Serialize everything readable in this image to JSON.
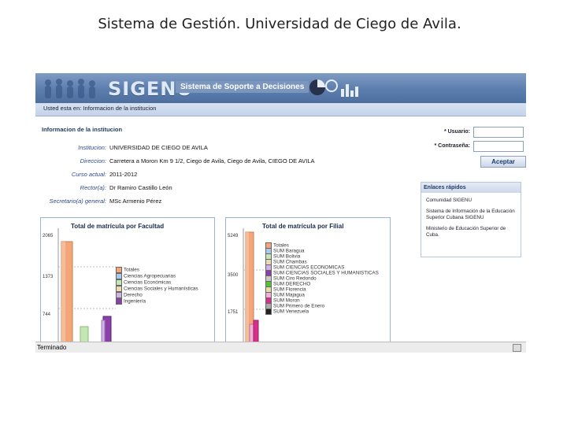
{
  "slide_title": "Sistema de Gestión. Universidad de Ciego de Avila.",
  "app": {
    "brand": "SIGENU",
    "subtitle": "Sistema de Soporte a Decisiones"
  },
  "breadcrumb": "Usted esta en: Informacion de la institucion",
  "institution": {
    "section_title": "Informacion de la institucion",
    "rows": [
      {
        "label": "Institucion:",
        "value": "UNIVERSIDAD DE CIEGO DE AVILA"
      },
      {
        "label": "Direccion:",
        "value": "Carretera a Moron Km 9 1/2, Ciego de Avila, Ciego de Avila, CIEGO DE AVILA"
      },
      {
        "label": "Curso actual:",
        "value": "2011-2012"
      },
      {
        "label": "Rector(a):",
        "value": "Dr Ramiro Castillo León"
      },
      {
        "label": "Secretario(a) general:",
        "value": "MSc Armenio Pérez"
      }
    ]
  },
  "login": {
    "user_label": "* Usuario:",
    "pass_label": "* Contraseña:",
    "submit": "Aceptar"
  },
  "quick_links": {
    "title": "Enlaces rápidos",
    "items": [
      "Comunidad SIGENU",
      "Sistema de Información de la Educación Superior Cubana SIGENU",
      "Ministerio de Educación Superior de Cuba."
    ]
  },
  "chart_faculty": {
    "title": "Total de matrícula por Facultad",
    "y_ticks": [
      "2065",
      "1373",
      "744"
    ],
    "legend": [
      {
        "name": "Totales",
        "color": "#f2a679"
      },
      {
        "name": "Ciencias Agropecuarias",
        "color": "#a9c9ec"
      },
      {
        "name": "Ciencias Económicas",
        "color": "#c4e6b2"
      },
      {
        "name": "Ciencias Sociales y Humanísticas",
        "color": "#eadbb4"
      },
      {
        "name": "Derecho",
        "color": "#d1b2e6"
      },
      {
        "name": "Ingeniería",
        "color": "#8b3fa8"
      }
    ]
  },
  "chart_branch": {
    "title": "Total de matrícula por Filial",
    "y_ticks": [
      "5249",
      "3500",
      "1751"
    ],
    "legend": [
      {
        "name": "Totales",
        "color": "#f2a679"
      },
      {
        "name": "SUM Baragua",
        "color": "#a9c9ec"
      },
      {
        "name": "SUM Bolivia",
        "color": "#c4e6b2"
      },
      {
        "name": "SUM Chambas",
        "color": "#eadbb4"
      },
      {
        "name": "SUM CIENCIAS ECONOMICAS",
        "color": "#d1b2e6"
      },
      {
        "name": "SUM CIENCIAS SOCIALES Y HUMANISTICAS",
        "color": "#8b3fa8"
      },
      {
        "name": "SUM Ciro Redondo",
        "color": "#c9c9c9"
      },
      {
        "name": "SUM DERECHO",
        "color": "#52c23a"
      },
      {
        "name": "SUM Florencia",
        "color": "#e7dca7"
      },
      {
        "name": "SUM Majagua",
        "color": "#f0b0d8"
      },
      {
        "name": "SUM Moron",
        "color": "#d82f8e"
      },
      {
        "name": "SUM Primero de Enero",
        "color": "#aaaaaa"
      },
      {
        "name": "SUM Venezuela",
        "color": "#222222"
      }
    ]
  },
  "status": "Terminado"
}
